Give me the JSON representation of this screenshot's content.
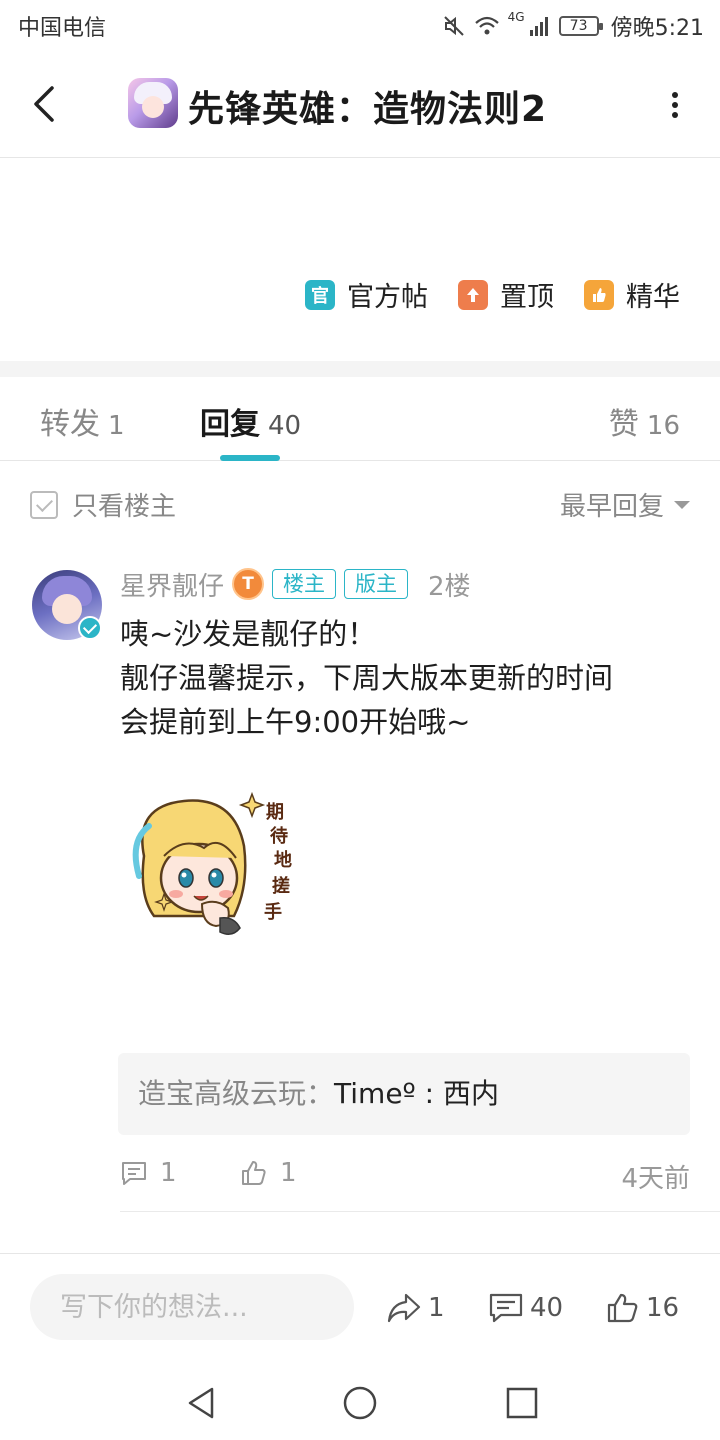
{
  "status_bar": {
    "carrier": "中国电信",
    "network": "4G",
    "battery": "73",
    "time": "傍晚5:21"
  },
  "header": {
    "title": "先锋英雄：造物法则2",
    "back_icon": "chevron-left-icon",
    "more_icon": "more-vertical-icon"
  },
  "post": {
    "tags": [
      {
        "icon_text": "官",
        "label": "官方帖",
        "color": "#2bb5c7"
      },
      {
        "icon_text": "↑",
        "label": "置顶",
        "color": "#ee7d4c"
      },
      {
        "icon_text": "👍",
        "label": "精华",
        "color": "#f5a53a"
      }
    ]
  },
  "tabs": {
    "forward_label": "转发",
    "forward_count": "1",
    "reply_label": "回复",
    "reply_count": "40",
    "like_label": "赞",
    "like_count": "16",
    "active": "reply",
    "accent_color": "#2bb5c7"
  },
  "filter": {
    "only_op_label": "只看楼主",
    "sort_label": "最早回复"
  },
  "reply": {
    "username": "星界靓仔",
    "level": "T",
    "badges": [
      "楼主",
      "版主"
    ],
    "floor": "2楼",
    "lines": [
      "咦~沙发是靓仔的！",
      "靓仔温馨提示，下周大版本更新的时间",
      "会提前到上午9:00开始哦~"
    ],
    "sticker_text": "期待地搓手",
    "quote_author": "造宝高级云玩：",
    "quote_text": "Timeº : 西内",
    "comment_count": "1",
    "like_count": "1",
    "time_ago": "4天前"
  },
  "bottom_bar": {
    "input_placeholder": "写下你的想法...",
    "share_count": "1",
    "comment_count": "40",
    "like_count": "16"
  }
}
